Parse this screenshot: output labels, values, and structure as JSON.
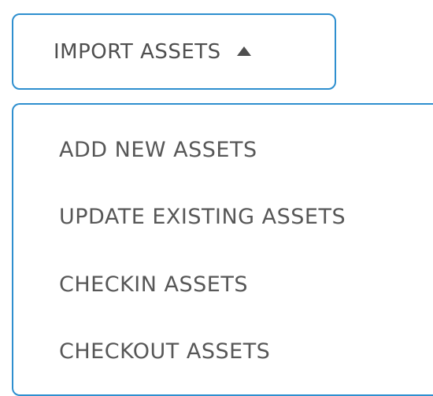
{
  "dropdown": {
    "toggle_label": "IMPORT ASSETS",
    "caret_icon": "caret-up-icon",
    "expanded": true,
    "items": [
      {
        "label": "ADD NEW ASSETS"
      },
      {
        "label": "UPDATE EXISTING ASSETS"
      },
      {
        "label": "CHECKIN ASSETS"
      },
      {
        "label": "CHECKOUT ASSETS"
      }
    ]
  },
  "colors": {
    "border": "#2e8fcf",
    "text": "#4f4f4f",
    "background": "#ffffff"
  }
}
